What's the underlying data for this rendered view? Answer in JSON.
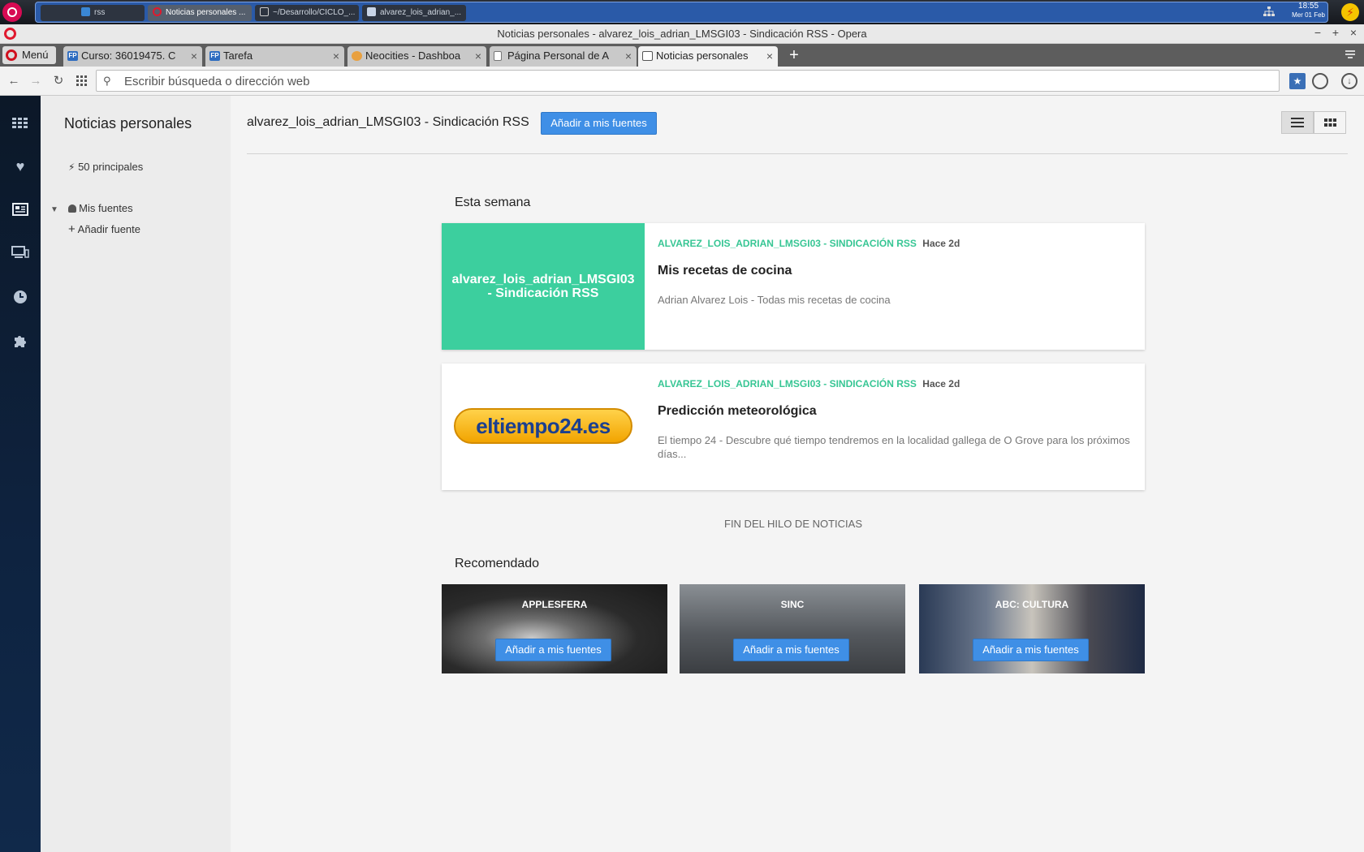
{
  "system": {
    "tasks": [
      {
        "label": "rss",
        "icon": "folder-icon"
      },
      {
        "label": "Noticias personales ...",
        "icon": "opera-icon"
      },
      {
        "label": "~/Desarrollo/CICLO_...",
        "icon": "terminal-icon"
      },
      {
        "label": "alvarez_lois_adrian_...",
        "icon": "document-icon"
      }
    ],
    "time": "18:55",
    "date": "Mer 01 Feb"
  },
  "window": {
    "title": "Noticias personales - alvarez_lois_adrian_LMSGI03 - Sindicación RSS - Opera",
    "controls": [
      "−",
      "+",
      "×"
    ]
  },
  "tabs": {
    "menu_label": "Menú",
    "items": [
      {
        "label": "Curso: 36019475. C",
        "favicon": "FP"
      },
      {
        "label": "Tarefa",
        "favicon": "FP"
      },
      {
        "label": "Neocities - Dashboa",
        "favicon": "cat"
      },
      {
        "label": "Página Personal de A",
        "favicon": "doc"
      },
      {
        "label": "Noticias personales",
        "favicon": "news"
      }
    ],
    "close": "×",
    "new_tab": "+"
  },
  "address": {
    "placeholder": "Escribir búsqueda o dirección web"
  },
  "news_panel": {
    "title": "Noticias personales",
    "top_label": "50 principales",
    "my_sources": "Mis fuentes",
    "add_source": "Añadir fuente"
  },
  "main": {
    "feed_title": "alvarez_lois_adrian_LMSGI03 - Sindicación RSS",
    "add_button": "Añadir a mis fuentes",
    "this_week": "Esta semana",
    "cards": [
      {
        "thumb_text": "alvarez_lois_adrian_LMSGI03 - Sindicación RSS",
        "source": "ALVAREZ_LOIS_ADRIAN_LMSGI03 - SINDICACIÓN RSS",
        "ago": "Hace 2d",
        "title": "Mis recetas de cocina",
        "desc": "Adrian Alvarez Lois - Todas mis recetas de cocina"
      },
      {
        "thumb_logo": "eltiempo24.es",
        "source": "ALVAREZ_LOIS_ADRIAN_LMSGI03 - SINDICACIÓN RSS",
        "ago": "Hace 2d",
        "title": "Predicción meteorológica",
        "desc": "El tiempo 24 - Descubre qué tiempo tendremos en la localidad gallega de O Grove para los próximos días..."
      }
    ],
    "end_text": "FIN DEL HILO DE NOTICIAS",
    "recommended": "Recomendado",
    "recs": [
      {
        "name": "APPLESFERA",
        "button": "Añadir a mis fuentes"
      },
      {
        "name": "SINC",
        "button": "Añadir a mis fuentes"
      },
      {
        "name": "ABC: CULTURA",
        "button": "Añadir a mis fuentes"
      }
    ]
  },
  "colors": {
    "accent_green": "#3ccf9e",
    "button_blue": "#3f8fe6",
    "sidebar_dark": "#0e2340"
  }
}
